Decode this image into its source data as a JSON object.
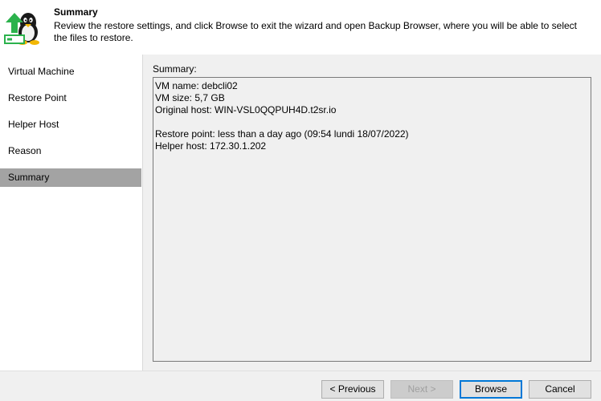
{
  "header": {
    "title": "Summary",
    "description": "Review the restore settings, and click Browse to exit the wizard and open Backup Browser, where you will be able to select the files to restore.",
    "icon": "linux-penguin-restore-icon"
  },
  "nav": {
    "items": [
      {
        "label": "Virtual Machine",
        "active": false
      },
      {
        "label": "Restore Point",
        "active": false
      },
      {
        "label": "Helper Host",
        "active": false
      },
      {
        "label": "Reason",
        "active": false
      },
      {
        "label": "Summary",
        "active": true
      }
    ]
  },
  "main": {
    "summary_label": "Summary:",
    "summary_lines": [
      "VM name: debcli02",
      "VM size: 5,7 GB",
      "Original host: WIN-VSL0QQPUH4D.t2sr.io",
      "",
      "Restore point: less than a day ago (09:54 lundi 18/07/2022)",
      "Helper host: 172.30.1.202"
    ]
  },
  "buttons": {
    "previous": "< Previous",
    "next": "Next >",
    "browse": "Browse",
    "cancel": "Cancel"
  },
  "colors": {
    "nav_active": "#a3a3a3",
    "icon_green": "#2bb24c",
    "primary_border": "#0078d7"
  }
}
